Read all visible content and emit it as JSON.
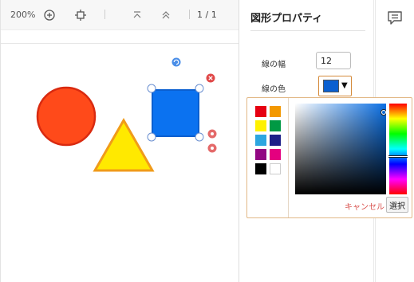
{
  "toolbar": {
    "zoom": "200%",
    "page_indicator": "1 / 1"
  },
  "canvas": {
    "shapes": {
      "circle": {
        "fill": "#ff4a1a",
        "stroke": "#d92a10"
      },
      "triangle": {
        "fill": "#ffe900",
        "stroke": "#f09b1a"
      },
      "rectangle": {
        "fill": "#0b72f0",
        "stroke": "#0a5fd0",
        "selected": true
      }
    },
    "handles": [
      "rotate-icon",
      "delete-icon",
      "bring-forward-icon",
      "send-backward-icon"
    ]
  },
  "panel": {
    "title": "図形プロパティ",
    "line_width_label": "線の幅",
    "line_width_value": "12",
    "line_color_label": "線の色",
    "line_color_value": "#0a5fd0"
  },
  "color_picker": {
    "presets": [
      "#e60012",
      "#f39800",
      "#fff100",
      "#009944",
      "#2ca6e0",
      "#1d2088",
      "#920783",
      "#e4007f",
      "#000000",
      "#ffffff"
    ],
    "current_hue": "#0a6fe4",
    "saturation": 0.97,
    "value": 0.9,
    "hue_position": 0.59,
    "cancel_label": "キャンセル",
    "select_label": "選択"
  },
  "icons": {
    "zoom_in": "zoom-in-icon",
    "fit": "fit-page-icon",
    "first_page": "first-page-icon",
    "prev_page": "previous-page-icon",
    "comment": "comment-icon"
  }
}
